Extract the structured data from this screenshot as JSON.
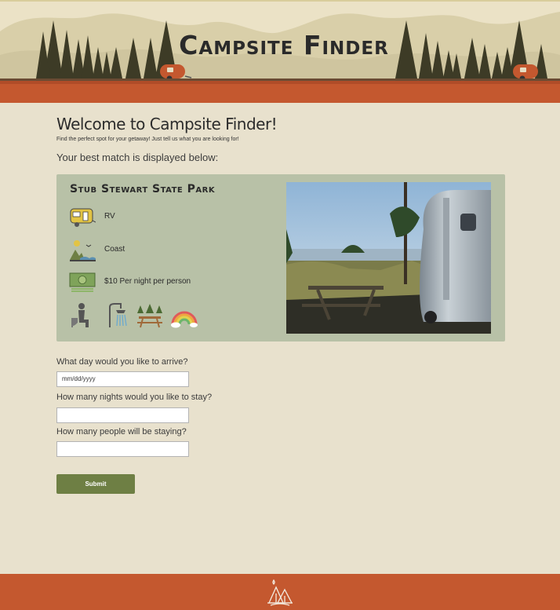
{
  "header": {
    "title": "Campsite Finder"
  },
  "intro": {
    "heading": "Welcome to Campsite Finder!",
    "tagline": "Find the perfect spot for your getaway! Just tell us what you are looking for!",
    "match_text": "Your best match is displayed below:"
  },
  "result": {
    "park_name": "Stub Stewart State Park",
    "features": [
      {
        "icon": "rv-trailer-icon",
        "label": "RV"
      },
      {
        "icon": "coast-icon",
        "label": "Coast"
      },
      {
        "icon": "money-icon",
        "label": "$10 Per night per person"
      }
    ],
    "amenities": [
      "toilet-icon",
      "shower-icon",
      "picnic-table-icon",
      "rainbow-icon"
    ]
  },
  "form": {
    "arrive_label": "What day would you like to arrive?",
    "arrive_placeholder": "mm/dd/yyyy",
    "nights_label": "How many nights would you like to stay?",
    "people_label": "How many people will be staying?",
    "submit_label": "Submit"
  },
  "colors": {
    "background": "#e8e1cd",
    "header_band": "#c4582f",
    "card": "#b8c1a7",
    "submit": "#6e7f44",
    "footer": "#c4582f"
  }
}
